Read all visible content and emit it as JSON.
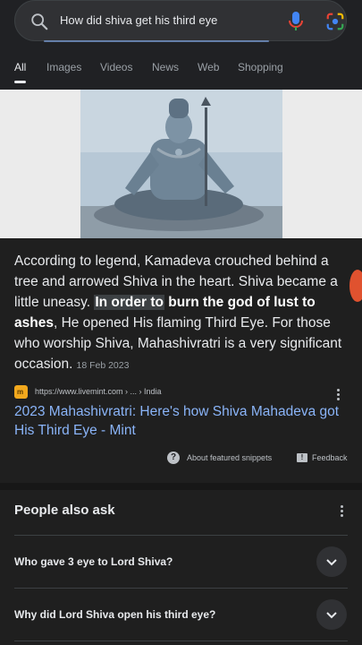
{
  "search": {
    "query": "How did shiva get his third eye",
    "icons": {
      "search": "search-icon",
      "mic": "mic-icon",
      "lens": "lens-icon"
    }
  },
  "tabs": [
    {
      "label": "All",
      "active": true
    },
    {
      "label": "Images"
    },
    {
      "label": "Videos"
    },
    {
      "label": "News"
    },
    {
      "label": "Web"
    },
    {
      "label": "Shopping"
    }
  ],
  "snippet": {
    "part1": "According to legend, Kamadeva crouched behind a tree and arrowed Shiva in the heart. Shiva became a little uneasy. ",
    "highlight": "In order to",
    "part2": " burn the god of lust to ashes",
    "part3": ", He opened His flaming Third Eye. For those who worship Shiva, Mahashivratri is a very significant occasion.",
    "date": "18 Feb 2023"
  },
  "source": {
    "url": "https://www.livemint.com › ... › India",
    "favicon_letter": "m"
  },
  "result": {
    "title": "2023 Mahashivratri: Here's how Shiva Mahadeva got His Third Eye - Mint"
  },
  "footer": {
    "about": "About featured snippets",
    "feedback": "Feedback"
  },
  "paa": {
    "title": "People also ask",
    "questions": [
      "Who gave 3 eye to Lord Shiva?",
      "Why did Lord Shiva open his third eye?"
    ]
  },
  "colors": {
    "background": "#1f1f1f",
    "link": "#8ab4f8",
    "text": "#e8eaed"
  }
}
